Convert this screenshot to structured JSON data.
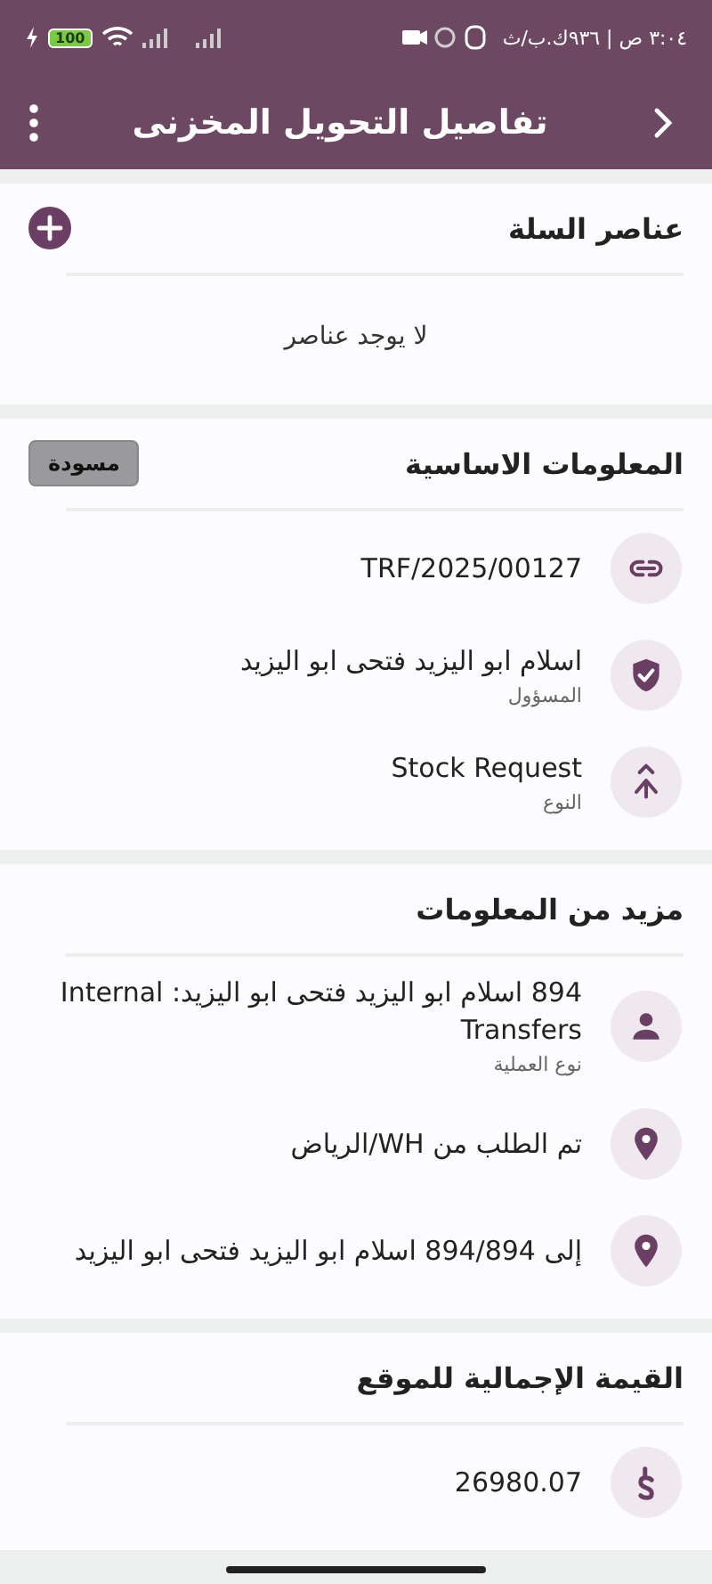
{
  "status_bar": {
    "time": "٣:٠٤ ص | ٩٣٦ك.ب/ث",
    "battery": "100"
  },
  "app_bar": {
    "title": "تفاصيل التحويل المخزنى"
  },
  "sections": [
    {
      "title": "عناصر السلة",
      "kind": "empty",
      "has_add": true,
      "empty_text": "لا يوجد عناصر"
    },
    {
      "title": "المعلومات الاساسية",
      "kind": "rows",
      "badge": "مسودة",
      "rows": [
        {
          "kind": "link",
          "value": "TRF/2025/00127"
        },
        {
          "kind": "shield",
          "value": "اسلام ابو اليزيد فتحى ابو اليزيد",
          "label": "المسؤول"
        },
        {
          "kind": "merge",
          "value": "Stock Request",
          "label": "النوع"
        }
      ]
    },
    {
      "title": "مزيد من المعلومات",
      "kind": "rows",
      "rows": [
        {
          "kind": "person",
          "value": "894 اسلام ابو اليزيد فتحى ابو اليزيد: Internal Transfers",
          "label": "نوع العملية"
        },
        {
          "kind": "pin",
          "value": "تم الطلب من WH/الرياض"
        },
        {
          "kind": "pin",
          "value": "إلى 894/894 اسلام ابو اليزيد فتحى ابو اليزيد"
        }
      ]
    },
    {
      "title": "القيمة الإجمالية للموقع",
      "kind": "rows",
      "rows": [
        {
          "kind": "money",
          "value": "26980.07"
        }
      ]
    }
  ]
}
